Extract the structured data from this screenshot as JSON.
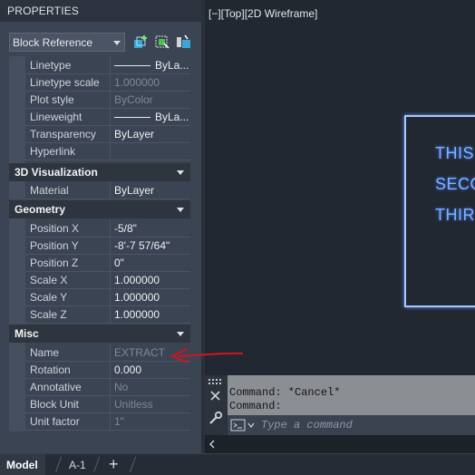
{
  "palette": {
    "title": "PROPERTIES",
    "object_select": "Block Reference"
  },
  "general_rows": [
    {
      "label": "Linetype",
      "value": "ByLa...",
      "line": true,
      "dim": false
    },
    {
      "label": "Linetype scale",
      "value": "1.000000",
      "line": false,
      "dim": true
    },
    {
      "label": "Plot style",
      "value": "ByColor",
      "line": false,
      "dim": true
    },
    {
      "label": "Lineweight",
      "value": "ByLa...",
      "line": true,
      "dim": false
    },
    {
      "label": "Transparency",
      "value": "ByLayer",
      "line": false,
      "dim": false
    },
    {
      "label": "Hyperlink",
      "value": "",
      "line": false,
      "dim": false
    }
  ],
  "sections": {
    "visualization": "3D Visualization",
    "geometry": "Geometry",
    "misc": "Misc"
  },
  "visualization_rows": [
    {
      "label": "Material",
      "value": "ByLayer",
      "dim": false
    }
  ],
  "geometry_rows": [
    {
      "label": "Position X",
      "value": "-5/8\"",
      "dim": false
    },
    {
      "label": "Position Y",
      "value": "-8'-7 57/64\"",
      "dim": false
    },
    {
      "label": "Position Z",
      "value": "0\"",
      "dim": false
    },
    {
      "label": "Scale X",
      "value": "1.000000",
      "dim": false
    },
    {
      "label": "Scale Y",
      "value": "1.000000",
      "dim": false
    },
    {
      "label": "Scale Z",
      "value": "1.000000",
      "dim": false
    }
  ],
  "misc_rows": [
    {
      "label": "Name",
      "value": "EXTRACT",
      "dim": true
    },
    {
      "label": "Rotation",
      "value": "0.000",
      "dim": false
    },
    {
      "label": "Annotative",
      "value": "No",
      "dim": true
    },
    {
      "label": "Block Unit",
      "value": "Unitless",
      "dim": true
    },
    {
      "label": "Unit factor",
      "value": "1\"",
      "dim": true
    }
  ],
  "viewport": {
    "label": "[−][Top][2D Wireframe]",
    "mtext_lines": [
      "THIS",
      "SECO",
      "THIR"
    ]
  },
  "command": {
    "history": [
      "Command: *Cancel*",
      "Command:"
    ],
    "placeholder": "Type a command"
  },
  "tabs": {
    "model": "Model",
    "layout1": "A-1",
    "add": "+"
  },
  "colors": {
    "annotation_arrow": "#d2141e",
    "mtext": "#7fb0ff"
  }
}
